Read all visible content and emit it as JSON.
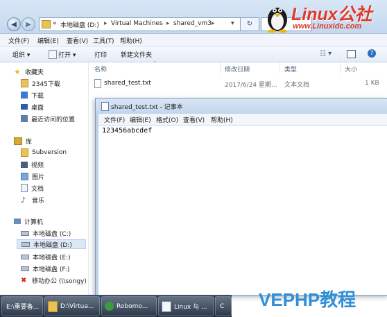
{
  "address": {
    "back_icon": "back-arrow-icon",
    "forward_icon": "forward-arrow-icon",
    "prefix": "«",
    "segments": [
      "本地磁盘 (D:)",
      "Virtual Machines",
      "shared_vm3"
    ],
    "separator": "▸"
  },
  "menubar": [
    "文件(F)",
    "编辑(E)",
    "查看(V)",
    "工具(T)",
    "帮助(H)"
  ],
  "toolbar": {
    "organize": "组织 ▾",
    "open": "打开 ▾",
    "print": "打印",
    "new_folder": "新建文件夹"
  },
  "sidebar": {
    "favorites_header": "收藏夹",
    "favorites": [
      "2345下载",
      "下载",
      "桌面",
      "最近访问的位置"
    ],
    "libraries_header": "库",
    "libraries": [
      "Subversion",
      "视频",
      "图片",
      "文档",
      "音乐"
    ],
    "computer_header": "计算机",
    "drives": [
      "本地磁盘 (C:)",
      "本地磁盘 (D:)",
      "本地磁盘 (E:)",
      "本地磁盘 (F:)",
      "移动办公 (\\\\songy)"
    ],
    "selected_drive_index": 1
  },
  "columns": [
    "名称",
    "修改日期",
    "类型",
    "大小"
  ],
  "files": [
    {
      "name": "shared_test.txt",
      "modified": "2017/6/24 星期...",
      "type": "文本文档",
      "size": "1 KB"
    }
  ],
  "notepad": {
    "title": "shared_test.txt - 记事本",
    "menu": [
      "文件(F)",
      "编辑(E)",
      "格式(O)",
      "查看(V)",
      "帮助(H)"
    ],
    "content": "123456abcdef"
  },
  "taskbar": [
    {
      "label": "E:\\重要备...",
      "icon": "folder-icon"
    },
    {
      "label": "D:\\Virtua...",
      "icon": "folder-icon"
    },
    {
      "label": "Robomo...",
      "icon": "robomongo-icon"
    },
    {
      "label": "Linux 与 ...",
      "icon": "document-icon"
    }
  ],
  "watermarks": {
    "linux_logo_text": "Linux公社",
    "linux_url": "www.Linuxidc.com",
    "bottom_brand": "VEPHP教程"
  },
  "colors": {
    "accent": "#2f8fd8",
    "selection": "#dde8f6",
    "taskbar": "#2a3a50",
    "linux_red": "#e0392b"
  }
}
